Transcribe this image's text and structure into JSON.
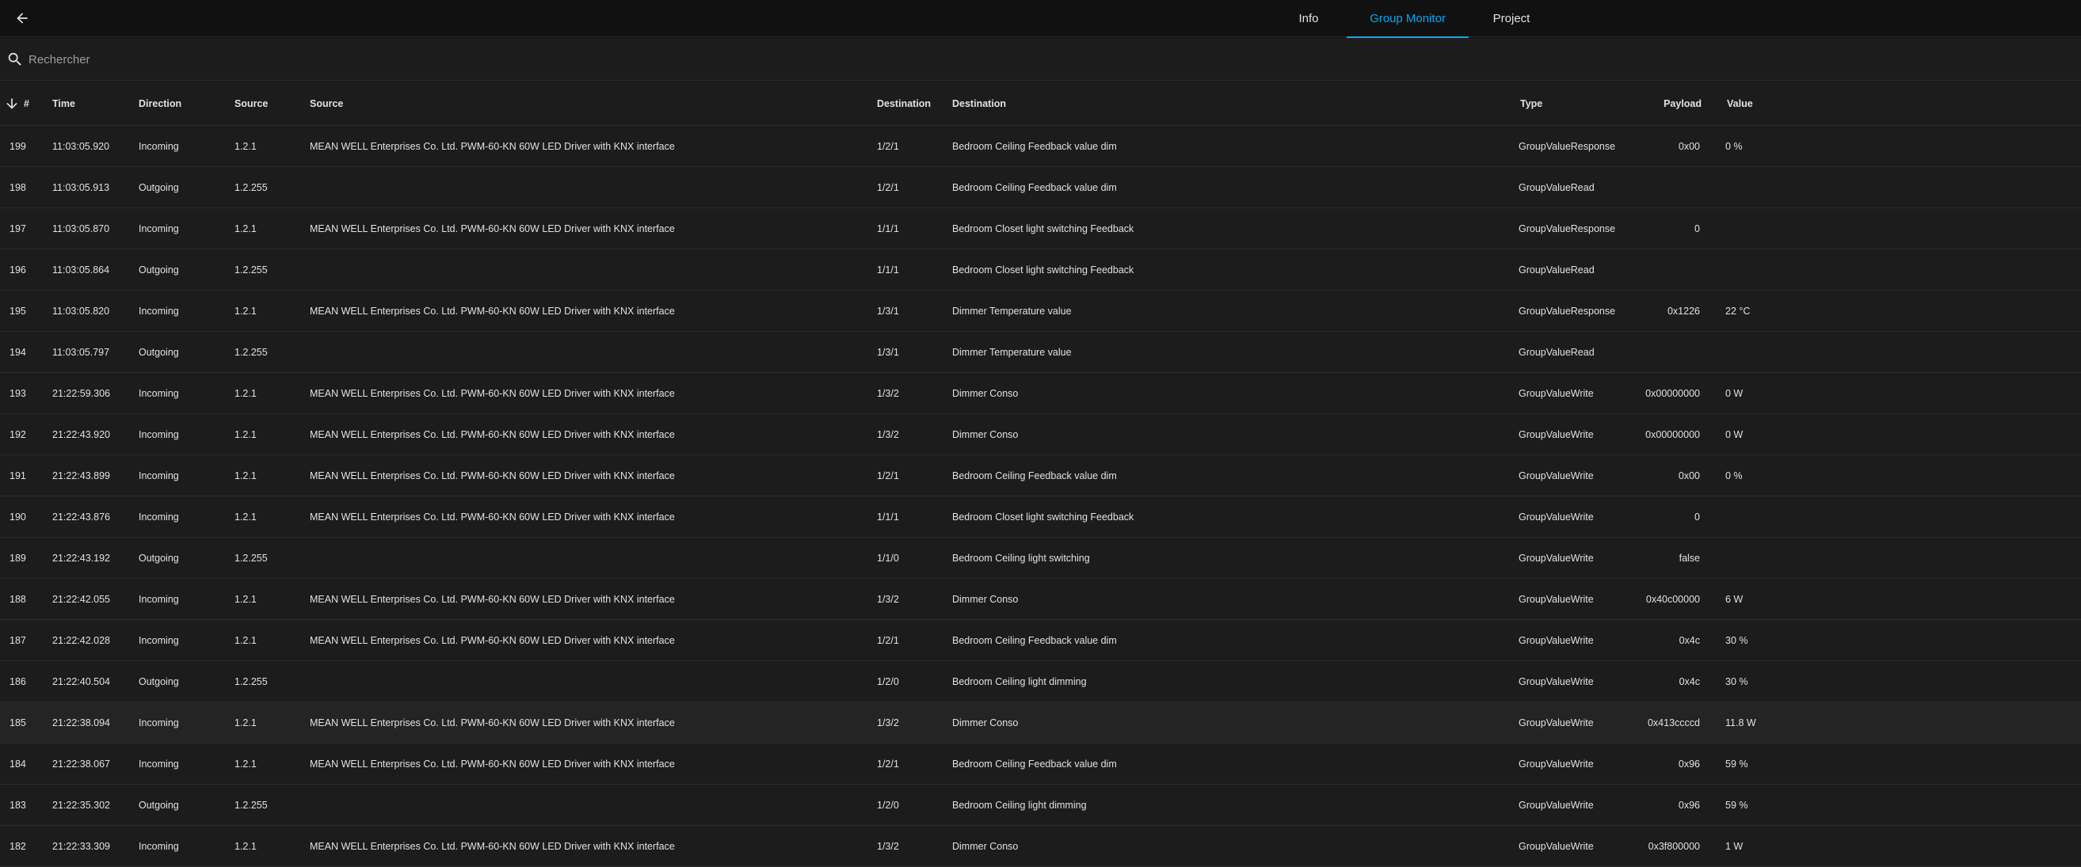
{
  "tabs": [
    {
      "label": "Info"
    },
    {
      "label": "Group Monitor"
    },
    {
      "label": "Project"
    }
  ],
  "search": {
    "placeholder": "Rechercher"
  },
  "columns": {
    "index": "#",
    "time": "Time",
    "direction": "Direction",
    "source": "Source",
    "source_name": "Source",
    "destination": "Destination",
    "destination_name": "Destination",
    "type": "Type",
    "payload": "Payload",
    "value": "Value"
  },
  "colors": {
    "accent": "#03a9f4",
    "background": "#1c1c1c",
    "row_divider": "#2c2c2c"
  },
  "rows": [
    {
      "index": "199",
      "time": "11:03:05.920",
      "direction": "Incoming",
      "source": "1.2.1",
      "source_name": "MEAN WELL Enterprises Co. Ltd. PWM-60-KN 60W LED Driver with KNX interface",
      "destination": "1/2/1",
      "destination_name": "Bedroom Ceiling Feedback value dim",
      "type": "GroupValueResponse",
      "payload": "0x00",
      "value": "0 %"
    },
    {
      "index": "198",
      "time": "11:03:05.913",
      "direction": "Outgoing",
      "source": "1.2.255",
      "source_name": "",
      "destination": "1/2/1",
      "destination_name": "Bedroom Ceiling Feedback value dim",
      "type": "GroupValueRead",
      "payload": "",
      "value": ""
    },
    {
      "index": "197",
      "time": "11:03:05.870",
      "direction": "Incoming",
      "source": "1.2.1",
      "source_name": "MEAN WELL Enterprises Co. Ltd. PWM-60-KN 60W LED Driver with KNX interface",
      "destination": "1/1/1",
      "destination_name": "Bedroom Closet light switching Feedback",
      "type": "GroupValueResponse",
      "payload": "0",
      "value": ""
    },
    {
      "index": "196",
      "time": "11:03:05.864",
      "direction": "Outgoing",
      "source": "1.2.255",
      "source_name": "",
      "destination": "1/1/1",
      "destination_name": "Bedroom Closet light switching Feedback",
      "type": "GroupValueRead",
      "payload": "",
      "value": ""
    },
    {
      "index": "195",
      "time": "11:03:05.820",
      "direction": "Incoming",
      "source": "1.2.1",
      "source_name": "MEAN WELL Enterprises Co. Ltd. PWM-60-KN 60W LED Driver with KNX interface",
      "destination": "1/3/1",
      "destination_name": "Dimmer Temperature value",
      "type": "GroupValueResponse",
      "payload": "0x1226",
      "value": "22 °C"
    },
    {
      "index": "194",
      "time": "11:03:05.797",
      "direction": "Outgoing",
      "source": "1.2.255",
      "source_name": "",
      "destination": "1/3/1",
      "destination_name": "Dimmer Temperature value",
      "type": "GroupValueRead",
      "payload": "",
      "value": ""
    },
    {
      "index": "193",
      "time": "21:22:59.306",
      "direction": "Incoming",
      "source": "1.2.1",
      "source_name": "MEAN WELL Enterprises Co. Ltd. PWM-60-KN 60W LED Driver with KNX interface",
      "destination": "1/3/2",
      "destination_name": "Dimmer Conso",
      "type": "GroupValueWrite",
      "payload": "0x00000000",
      "value": "0 W"
    },
    {
      "index": "192",
      "time": "21:22:43.920",
      "direction": "Incoming",
      "source": "1.2.1",
      "source_name": "MEAN WELL Enterprises Co. Ltd. PWM-60-KN 60W LED Driver with KNX interface",
      "destination": "1/3/2",
      "destination_name": "Dimmer Conso",
      "type": "GroupValueWrite",
      "payload": "0x00000000",
      "value": "0 W"
    },
    {
      "index": "191",
      "time": "21:22:43.899",
      "direction": "Incoming",
      "source": "1.2.1",
      "source_name": "MEAN WELL Enterprises Co. Ltd. PWM-60-KN 60W LED Driver with KNX interface",
      "destination": "1/2/1",
      "destination_name": "Bedroom Ceiling Feedback value dim",
      "type": "GroupValueWrite",
      "payload": "0x00",
      "value": "0 %"
    },
    {
      "index": "190",
      "time": "21:22:43.876",
      "direction": "Incoming",
      "source": "1.2.1",
      "source_name": "MEAN WELL Enterprises Co. Ltd. PWM-60-KN 60W LED Driver with KNX interface",
      "destination": "1/1/1",
      "destination_name": "Bedroom Closet light switching Feedback",
      "type": "GroupValueWrite",
      "payload": "0",
      "value": ""
    },
    {
      "index": "189",
      "time": "21:22:43.192",
      "direction": "Outgoing",
      "source": "1.2.255",
      "source_name": "",
      "destination": "1/1/0",
      "destination_name": "Bedroom Ceiling light switching",
      "type": "GroupValueWrite",
      "payload": "false",
      "value": ""
    },
    {
      "index": "188",
      "time": "21:22:42.055",
      "direction": "Incoming",
      "source": "1.2.1",
      "source_name": "MEAN WELL Enterprises Co. Ltd. PWM-60-KN 60W LED Driver with KNX interface",
      "destination": "1/3/2",
      "destination_name": "Dimmer Conso",
      "type": "GroupValueWrite",
      "payload": "0x40c00000",
      "value": "6 W"
    },
    {
      "index": "187",
      "time": "21:22:42.028",
      "direction": "Incoming",
      "source": "1.2.1",
      "source_name": "MEAN WELL Enterprises Co. Ltd. PWM-60-KN 60W LED Driver with KNX interface",
      "destination": "1/2/1",
      "destination_name": "Bedroom Ceiling Feedback value dim",
      "type": "GroupValueWrite",
      "payload": "0x4c",
      "value": "30 %"
    },
    {
      "index": "186",
      "time": "21:22:40.504",
      "direction": "Outgoing",
      "source": "1.2.255",
      "source_name": "",
      "destination": "1/2/0",
      "destination_name": "Bedroom Ceiling light dimming",
      "type": "GroupValueWrite",
      "payload": "0x4c",
      "value": "30 %"
    },
    {
      "index": "185",
      "time": "21:22:38.094",
      "direction": "Incoming",
      "source": "1.2.1",
      "source_name": "MEAN WELL Enterprises Co. Ltd. PWM-60-KN 60W LED Driver with KNX interface",
      "destination": "1/3/2",
      "destination_name": "Dimmer Conso",
      "type": "GroupValueWrite",
      "payload": "0x413ccccd",
      "value": "11.8 W"
    },
    {
      "index": "184",
      "time": "21:22:38.067",
      "direction": "Incoming",
      "source": "1.2.1",
      "source_name": "MEAN WELL Enterprises Co. Ltd. PWM-60-KN 60W LED Driver with KNX interface",
      "destination": "1/2/1",
      "destination_name": "Bedroom Ceiling Feedback value dim",
      "type": "GroupValueWrite",
      "payload": "0x96",
      "value": "59 %"
    },
    {
      "index": "183",
      "time": "21:22:35.302",
      "direction": "Outgoing",
      "source": "1.2.255",
      "source_name": "",
      "destination": "1/2/0",
      "destination_name": "Bedroom Ceiling light dimming",
      "type": "GroupValueWrite",
      "payload": "0x96",
      "value": "59 %"
    },
    {
      "index": "182",
      "time": "21:22:33.309",
      "direction": "Incoming",
      "source": "1.2.1",
      "source_name": "MEAN WELL Enterprises Co. Ltd. PWM-60-KN 60W LED Driver with KNX interface",
      "destination": "1/3/2",
      "destination_name": "Dimmer Conso",
      "type": "GroupValueWrite",
      "payload": "0x3f800000",
      "value": "1 W"
    }
  ]
}
